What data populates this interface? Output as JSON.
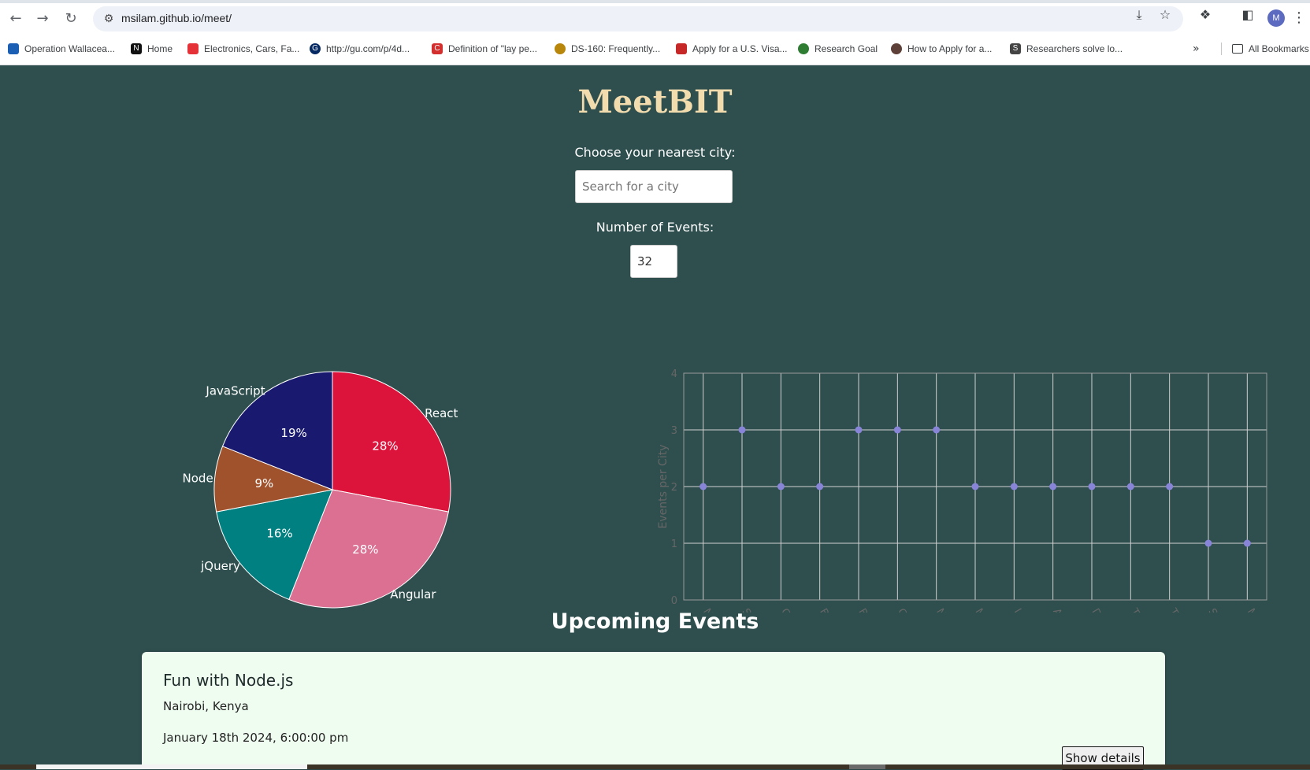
{
  "browser": {
    "url": "msilam.github.io/meet/",
    "avatar_letter": "M",
    "bookmarks": [
      {
        "label": "Operation Wallacea...",
        "icon": "op-wall-icon",
        "color": "#1a5fb4"
      },
      {
        "label": "Home",
        "icon": "notion-icon",
        "color": "#111111"
      },
      {
        "label": "Electronics, Cars, Fa...",
        "icon": "ebay-icon",
        "color": "#e53238"
      },
      {
        "label": "http://gu.com/p/4d...",
        "icon": "guardian-icon",
        "color": "#052962"
      },
      {
        "label": "Definition of \"lay pe...",
        "icon": "collins-icon",
        "color": "#d32f2f"
      },
      {
        "label": "DS-160: Frequently...",
        "icon": "gear-site-icon",
        "color": "#b8860b"
      },
      {
        "label": "Apply for a U.S. Visa...",
        "icon": "cgi-icon",
        "color": "#c62828"
      },
      {
        "label": "Research Goal",
        "icon": "globe-icon",
        "color": "#2e7d32"
      },
      {
        "label": "How to Apply for a...",
        "icon": "seal-icon",
        "color": "#5d4037"
      },
      {
        "label": "Researchers solve lo...",
        "icon": "sd-icon",
        "color": "#444444"
      }
    ],
    "all_bookmarks": "All Bookmarks"
  },
  "app": {
    "title": "MeetBIT",
    "city_label": "Choose your nearest city:",
    "city_placeholder": "Search for a city",
    "events_label": "Number of Events:",
    "events_value": "32",
    "upcoming_heading": "Upcoming Events"
  },
  "chart_data": [
    {
      "type": "pie",
      "categories": [
        "React",
        "Angular",
        "jQuery",
        "Node",
        "JavaScript"
      ],
      "values": [
        28,
        28,
        16,
        9,
        19
      ],
      "labels": [
        "28%",
        "28%",
        "16%",
        "9%",
        "19%"
      ],
      "colors": [
        "#dc143c",
        "#db7093",
        "#008080",
        "#a0522d",
        "#191970"
      ]
    },
    {
      "type": "scatter",
      "categories": [
        "Nairobi",
        "Santiago",
        "California",
        "Bangkok",
        "Berlin",
        "Cape Town",
        "New York",
        "Mumbai",
        "London",
        "Amsterdam",
        "Dubai",
        "Toronto",
        "Tokyo",
        "Sydney NSW",
        "Moscow"
      ],
      "values": [
        2,
        3,
        2,
        2,
        3,
        3,
        3,
        2,
        2,
        2,
        2,
        2,
        2,
        1,
        1
      ],
      "ylabel": "Events per City",
      "yticks": [
        "0",
        "1",
        "2",
        "3",
        "4"
      ],
      "ylim": [
        0,
        4
      ],
      "grid": true,
      "point_color": "#8884d8"
    }
  ],
  "events": [
    {
      "title": "Fun with Node.js",
      "location": "Nairobi, Kenya",
      "date": "January 18th 2024, 6:00:00 pm",
      "button": "Show details"
    }
  ]
}
